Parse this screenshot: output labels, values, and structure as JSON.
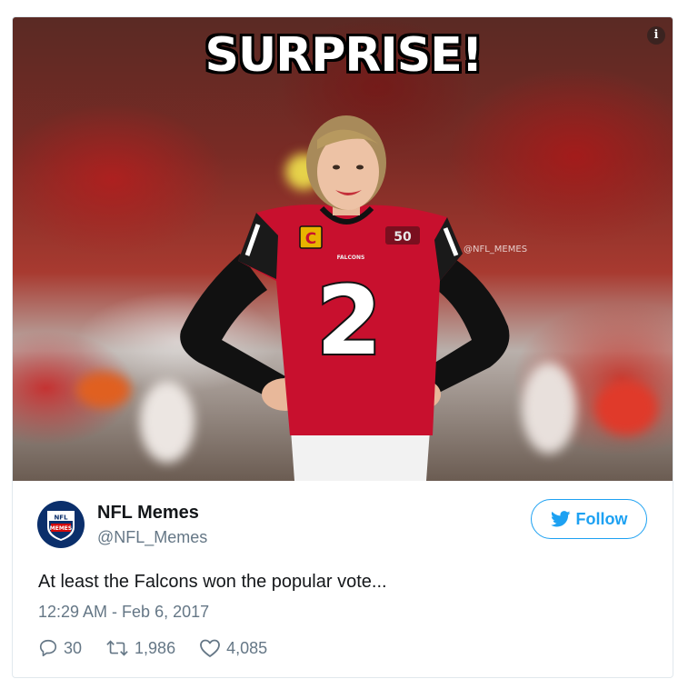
{
  "media": {
    "caption": "SURPRISE!",
    "watermark": "@NFL_MEMES",
    "jersey_number": "2",
    "captain_patch": "C",
    "anniversary_patch": "50",
    "jersey_wordmark": "FALCONS",
    "info_icon": "info-icon"
  },
  "author": {
    "name": "NFL Memes",
    "handle": "@NFL_Memes",
    "avatar_text": "NFL",
    "avatar_subtext": "MEMES"
  },
  "follow_button": {
    "label": "Follow",
    "icon": "twitter-bird-icon"
  },
  "tweet": {
    "text": "At least the Falcons won the popular vote...",
    "timestamp": "12:29 AM - Feb 6, 2017"
  },
  "stats": {
    "replies": "30",
    "retweets": "1,986",
    "likes": "4,085"
  },
  "colors": {
    "twitter_blue": "#1da1f2",
    "text_dark": "#14171a",
    "text_gray": "#657786",
    "falcons_red": "#c8102e"
  }
}
